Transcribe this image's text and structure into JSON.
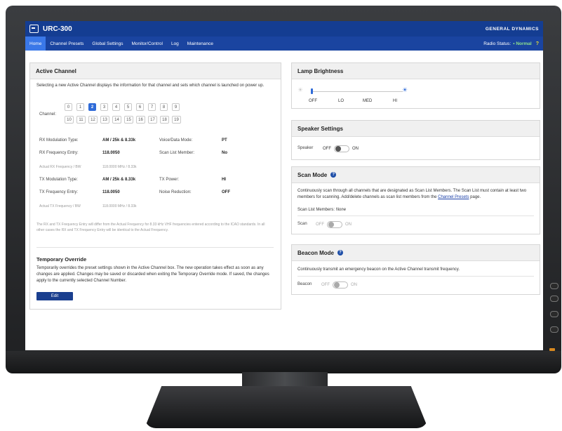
{
  "app": {
    "title": "URC-300",
    "brand": "GENERAL DYNAMICS"
  },
  "nav": {
    "items": [
      "Home",
      "Channel Presets",
      "Global Settings",
      "Monitor/Control",
      "Log",
      "Maintenance"
    ],
    "radio_status_label": "Radio Status:",
    "radio_status_value": "• Normal",
    "help": "?"
  },
  "active_channel": {
    "title": "Active Channel",
    "description": "Selecting a new Active Channel displays the information for that channel and sets which channel is launched on power up.",
    "channel_label": "Channel:",
    "channels": [
      "0",
      "1",
      "2",
      "3",
      "4",
      "5",
      "6",
      "7",
      "8",
      "9",
      "10",
      "11",
      "12",
      "13",
      "14",
      "15",
      "16",
      "17",
      "18",
      "19"
    ],
    "selected_channel": "2",
    "rx_mod_label": "RX Modulation Type:",
    "rx_mod_value": "AM / 25k & 8.33k",
    "voice_label": "Voice/Data Mode:",
    "voice_value": "PT",
    "rx_freq_label": "RX Frequency Entry:",
    "rx_freq_value": "118.0050",
    "scan_member_label": "Scan List Member:",
    "scan_member_value": "No",
    "actual_rx_label": "Actual RX Frequency / BW",
    "actual_rx_value": "118.0000 MHz / 8.33k",
    "tx_mod_label": "TX Modulation Type:",
    "tx_mod_value": "AM / 25k & 8.33k",
    "tx_power_label": "TX Power:",
    "tx_power_value": "HI",
    "tx_freq_label": "TX Frequency Entry:",
    "tx_freq_value": "118.0050",
    "noise_label": "Noise Reduction:",
    "noise_value": "OFF",
    "actual_tx_label": "Actual TX Frequency / BW",
    "actual_tx_value": "118.0000 MHz / 8.33k",
    "note": "The RX and TX Frequency Entry will differ from the Actual Frequency for 8.33 kHz VHF frequencies entered according to the ICAO standards. In all other cases the RX and TX Frequency Entry will be identical to the Actual Frequency."
  },
  "temp_override": {
    "title": "Temporary Override",
    "description": "Temporarily overrides the preset settings shown in the Active Channel box. The new operation takes effect as soon as any changes are applied. Changes may be saved or discarded when exiting the Temporary Override mode. If saved, the changes apply to the currently selected Channel Number.",
    "edit_label": "Edit"
  },
  "lamp": {
    "title": "Lamp Brightness",
    "labels": [
      "OFF",
      "LO",
      "MED",
      "HI"
    ],
    "level": 0
  },
  "speaker": {
    "title": "Speaker Settings",
    "label": "Speaker",
    "off": "OFF",
    "on": "ON",
    "state": "off"
  },
  "scan": {
    "title": "Scan Mode",
    "description_pre": "Continuously scan through all channels that are designated as Scan List Members. The Scan List must contain at least two members for scanning. Add/delete channels as scan list members from the",
    "link": "Channel Presets",
    "description_post": "page.",
    "members_label": "Scan List Members:",
    "members_value": "None",
    "toggle_label": "Scan",
    "off": "OFF",
    "on": "ON",
    "state": "off-disabled"
  },
  "beacon": {
    "title": "Beacon Mode",
    "description": "Continuously transmit an emergency beacon on the Active Channel transmit frequency.",
    "toggle_label": "Beacon",
    "off": "OFF",
    "on": "ON",
    "state": "off-disabled"
  },
  "colors": {
    "nav_bg": "#143d92",
    "active_tab": "#3a78e8",
    "accent": "#2f6bd8",
    "status_normal": "#8de08d",
    "power_led": "#d9891f"
  }
}
